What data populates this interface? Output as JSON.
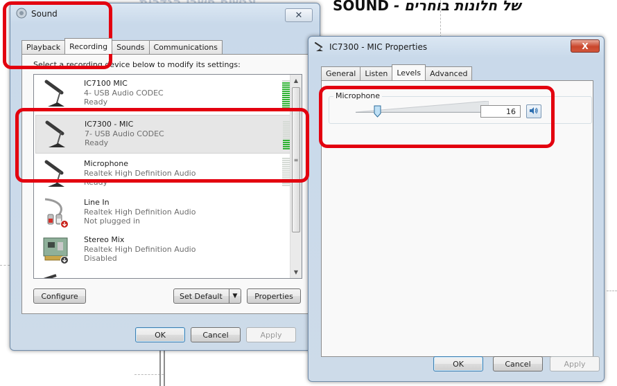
{
  "background": {
    "title_rtl": "של חלונות בוחרים",
    "title_sep": " - ",
    "title_en": "SOUND",
    "faded_text": "אנשים חשבו הגדרות"
  },
  "sound_window": {
    "title": "Sound",
    "close_glyph": "✕",
    "tabs": [
      "Playback",
      "Recording",
      "Sounds",
      "Communications"
    ],
    "active_tab": "Recording",
    "instruction": "Select a recording device below to modify its settings:",
    "devices": [
      {
        "name": "IC7100 MIC",
        "line1": "4- USB Audio CODEC",
        "line2": "Ready",
        "level": 0.9,
        "selected": false,
        "icon": "microphone-stand-icon"
      },
      {
        "name": "IC7300 - MIC",
        "line1": "7- USB Audio CODEC",
        "line2": "Ready",
        "level": 0.35,
        "selected": true,
        "icon": "microphone-stand-icon"
      },
      {
        "name": "Microphone",
        "line1": "Realtek High Definition Audio",
        "line2": "Ready",
        "level": 0.0,
        "selected": false,
        "icon": "microphone-stand-icon"
      },
      {
        "name": "Line In",
        "line1": "Realtek High Definition Audio",
        "line2": "Not plugged in",
        "selected": false,
        "icon": "line-in-cable-icon"
      },
      {
        "name": "Stereo Mix",
        "line1": "Realtek High Definition Audio",
        "line2": "Disabled",
        "selected": false,
        "icon": "sound-card-icon"
      }
    ],
    "buttons": {
      "configure": "Configure",
      "set_default": "Set Default",
      "properties": "Properties",
      "ok": "OK",
      "cancel": "Cancel",
      "apply": "Apply"
    }
  },
  "properties_window": {
    "title": "IC7300 - MIC Properties",
    "close_glyph": "X",
    "tabs": [
      "General",
      "Listen",
      "Levels",
      "Advanced"
    ],
    "active_tab": "Levels",
    "group_label": "Microphone",
    "level_value": "16",
    "level_fraction": 0.16,
    "buttons": {
      "ok": "OK",
      "cancel": "Cancel",
      "apply": "Apply"
    }
  },
  "colors": {
    "highlight": "#e3000f",
    "meter_on": "#2fb233",
    "meter_off": "#d6dbd6",
    "title_bar": "#c9d9ea"
  }
}
